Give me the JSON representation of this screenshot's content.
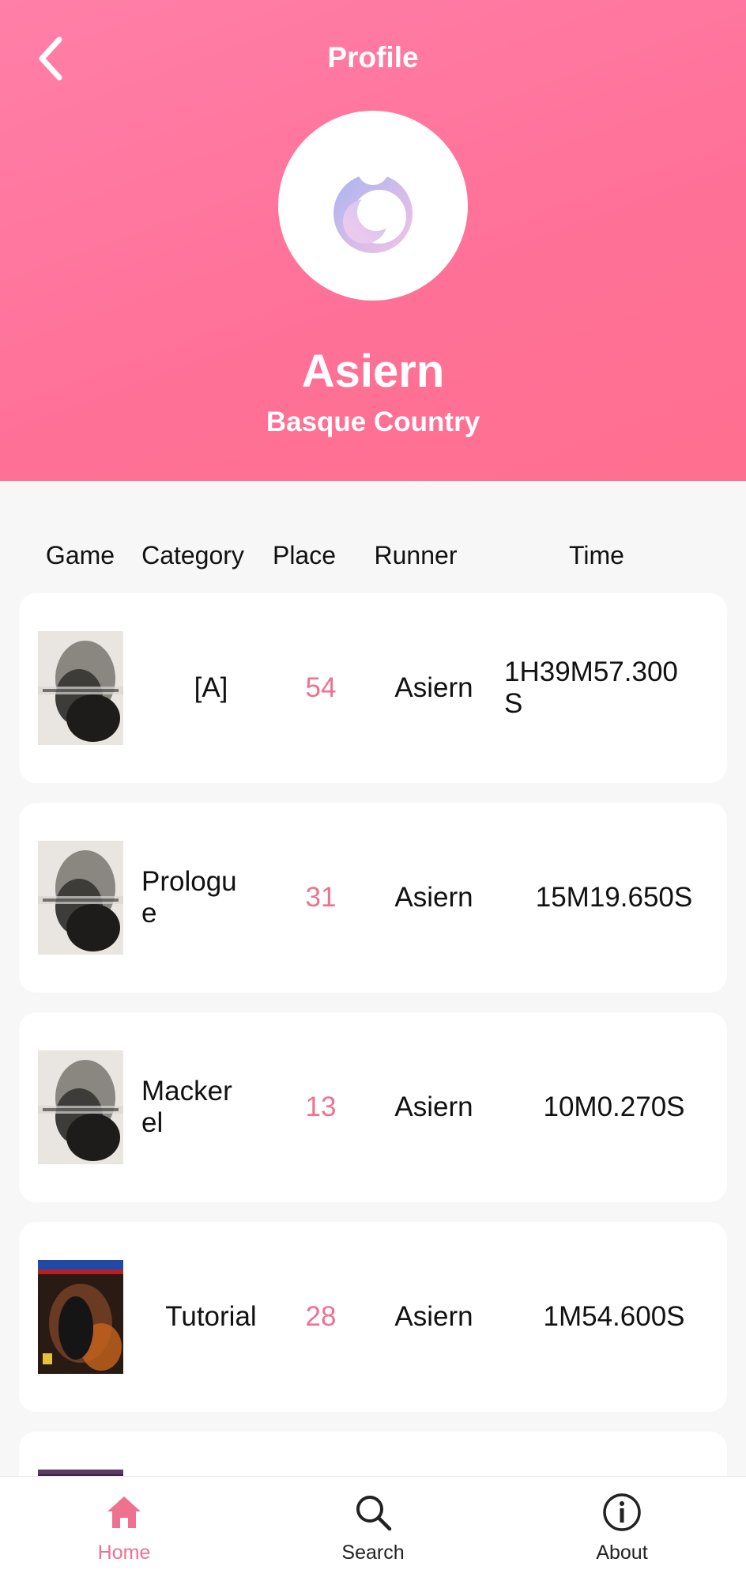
{
  "header": {
    "title": "Profile",
    "back_icon": "chevron-left-icon",
    "avatar_icon": "app-logo-icon",
    "username": "Asiern",
    "location": "Basque Country",
    "gradient_colors": [
      "#ff7fa8",
      "#ff6f8f"
    ]
  },
  "table": {
    "columns": [
      "Game",
      "Category",
      "Place",
      "Runner",
      "Time"
    ],
    "rows": [
      {
        "game_cover": "nier-automata-cover",
        "category": "[A]",
        "place": "54",
        "runner": "Asiern",
        "time": "1H39M57.300S"
      },
      {
        "game_cover": "nier-automata-cover",
        "category": "Prologue",
        "place": "31",
        "runner": "Asiern",
        "time": "15M19.650S"
      },
      {
        "game_cover": "nier-automata-cover",
        "category": "Mackerel",
        "place": "13",
        "runner": "Asiern",
        "time": "10M0.270S"
      },
      {
        "game_cover": "dead-by-daylight-cover",
        "category": "Tutorial",
        "place": "28",
        "runner": "Asiern",
        "time": "1M54.600S"
      }
    ]
  },
  "accent_color": "#ef7190",
  "bottom_nav": [
    {
      "label": "Home",
      "icon": "home-icon",
      "active": true
    },
    {
      "label": "Search",
      "icon": "search-icon",
      "active": false
    },
    {
      "label": "About",
      "icon": "info-icon",
      "active": false
    }
  ]
}
